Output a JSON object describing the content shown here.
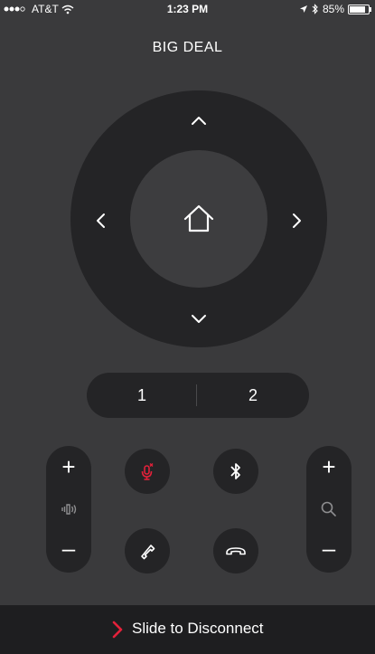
{
  "status": {
    "carrier": "AT&T",
    "time": "1:23 PM",
    "battery": "85%",
    "battery_level": 0.85,
    "signal_icon": "signal-dots-icon",
    "wifi_icon": "wifi-icon",
    "location_icon": "location-arrow-icon",
    "bluetooth_icon": "bluetooth-icon"
  },
  "header": {
    "title": "BIG DEAL"
  },
  "number_bar": {
    "one": "1",
    "two": "2"
  },
  "volume": {
    "plus": "+",
    "minus": "–"
  },
  "zoom": {
    "plus": "+",
    "minus": "–"
  },
  "footer": {
    "slide_label": "Slide to Disconnect"
  },
  "colors": {
    "background": "#3a3a3c",
    "control_dark": "#242426",
    "accent_red": "#e3213a",
    "text": "#ffffff"
  }
}
